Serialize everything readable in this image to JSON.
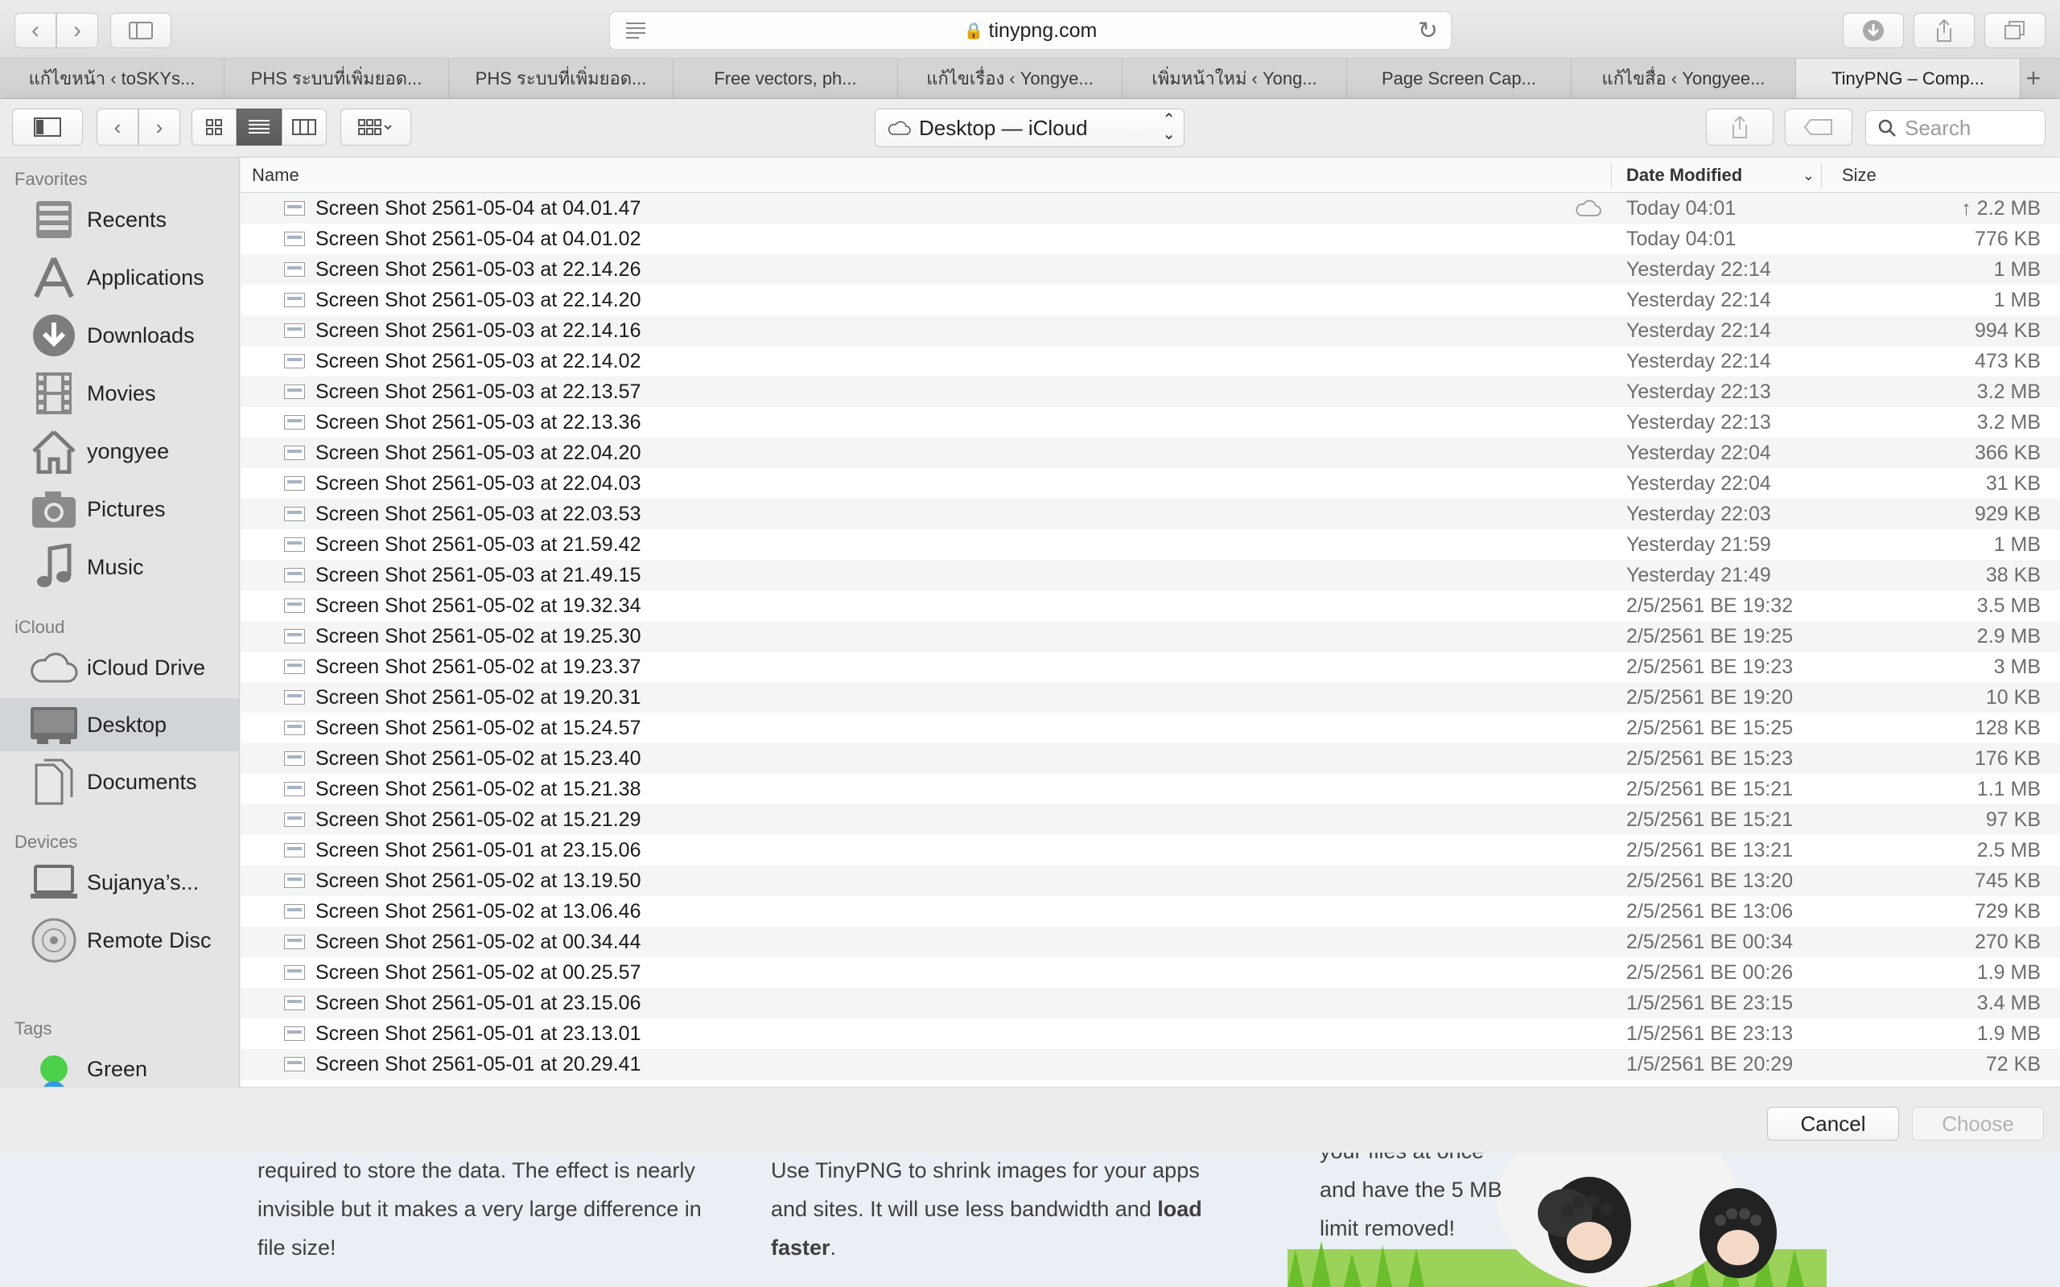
{
  "browser": {
    "url": "tinypng.com",
    "tabs": [
      {
        "label": "แก้ไขหน้า ‹ toSKYs..."
      },
      {
        "label": "PHS ระบบที่เพิ่มยอด..."
      },
      {
        "label": "PHS ระบบที่เพิ่มยอด..."
      },
      {
        "label": "Free vectors, ph..."
      },
      {
        "label": "แก้ไขเรื่อง ‹ Yongye..."
      },
      {
        "label": "เพิ่มหน้าใหม่ ‹ Yong..."
      },
      {
        "label": "Page Screen Cap..."
      },
      {
        "label": "แก้ไขสื่อ ‹ Yongyee..."
      },
      {
        "label": "TinyPNG – Comp..."
      }
    ]
  },
  "dialog": {
    "location": "Desktop — iCloud",
    "search_placeholder": "Search",
    "columns": {
      "name": "Name",
      "date": "Date Modified",
      "size": "Size"
    },
    "cancel_label": "Cancel",
    "choose_label": "Choose"
  },
  "sidebar": {
    "favorites_header": "Favorites",
    "favorites": [
      {
        "label": "Recents",
        "icon": "recents-icon"
      },
      {
        "label": "Applications",
        "icon": "applications-icon"
      },
      {
        "label": "Downloads",
        "icon": "downloads-icon"
      },
      {
        "label": "Movies",
        "icon": "movies-icon"
      },
      {
        "label": "yongyee",
        "icon": "home-icon"
      },
      {
        "label": "Pictures",
        "icon": "camera-icon"
      },
      {
        "label": "Music",
        "icon": "music-note-icon"
      }
    ],
    "icloud_header": "iCloud",
    "icloud": [
      {
        "label": "iCloud Drive",
        "icon": "cloud-icon"
      },
      {
        "label": "Desktop",
        "icon": "desktop-icon"
      },
      {
        "label": "Documents",
        "icon": "documents-icon"
      }
    ],
    "devices_header": "Devices",
    "devices": [
      {
        "label": "Sujanya’s...",
        "icon": "laptop-icon"
      },
      {
        "label": "Remote Disc",
        "icon": "disc-icon"
      }
    ],
    "tags_header": "Tags",
    "tags": [
      {
        "label": "Green",
        "color": "#4cd04b"
      }
    ]
  },
  "files": [
    {
      "name": "Screen Shot 2561-05-04 at 04.01.47",
      "date": "Today 04:01",
      "size": "↑ 2.2 MB",
      "cloud": true
    },
    {
      "name": "Screen Shot 2561-05-04 at 04.01.02",
      "date": "Today 04:01",
      "size": "776 KB"
    },
    {
      "name": "Screen Shot 2561-05-03 at 22.14.26",
      "date": "Yesterday 22:14",
      "size": "1 MB"
    },
    {
      "name": "Screen Shot 2561-05-03 at 22.14.20",
      "date": "Yesterday 22:14",
      "size": "1 MB"
    },
    {
      "name": "Screen Shot 2561-05-03 at 22.14.16",
      "date": "Yesterday 22:14",
      "size": "994 KB"
    },
    {
      "name": "Screen Shot 2561-05-03 at 22.14.02",
      "date": "Yesterday 22:14",
      "size": "473 KB"
    },
    {
      "name": "Screen Shot 2561-05-03 at 22.13.57",
      "date": "Yesterday 22:13",
      "size": "3.2 MB"
    },
    {
      "name": "Screen Shot 2561-05-03 at 22.13.36",
      "date": "Yesterday 22:13",
      "size": "3.2 MB"
    },
    {
      "name": "Screen Shot 2561-05-03 at 22.04.20",
      "date": "Yesterday 22:04",
      "size": "366 KB"
    },
    {
      "name": "Screen Shot 2561-05-03 at 22.04.03",
      "date": "Yesterday 22:04",
      "size": "31 KB"
    },
    {
      "name": "Screen Shot 2561-05-03 at 22.03.53",
      "date": "Yesterday 22:03",
      "size": "929 KB"
    },
    {
      "name": "Screen Shot 2561-05-03 at 21.59.42",
      "date": "Yesterday 21:59",
      "size": "1 MB"
    },
    {
      "name": "Screen Shot 2561-05-03 at 21.49.15",
      "date": "Yesterday 21:49",
      "size": "38 KB"
    },
    {
      "name": "Screen Shot 2561-05-02 at 19.32.34",
      "date": "2/5/2561 BE 19:32",
      "size": "3.5 MB"
    },
    {
      "name": "Screen Shot 2561-05-02 at 19.25.30",
      "date": "2/5/2561 BE 19:25",
      "size": "2.9 MB"
    },
    {
      "name": "Screen Shot 2561-05-02 at 19.23.37",
      "date": "2/5/2561 BE 19:23",
      "size": "3 MB"
    },
    {
      "name": "Screen Shot 2561-05-02 at 19.20.31",
      "date": "2/5/2561 BE 19:20",
      "size": "10 KB"
    },
    {
      "name": "Screen Shot 2561-05-02 at 15.24.57",
      "date": "2/5/2561 BE 15:25",
      "size": "128 KB"
    },
    {
      "name": "Screen Shot 2561-05-02 at 15.23.40",
      "date": "2/5/2561 BE 15:23",
      "size": "176 KB"
    },
    {
      "name": "Screen Shot 2561-05-02 at 15.21.38",
      "date": "2/5/2561 BE 15:21",
      "size": "1.1 MB"
    },
    {
      "name": "Screen Shot 2561-05-02 at 15.21.29",
      "date": "2/5/2561 BE 15:21",
      "size": "97 KB"
    },
    {
      "name": "Screen Shot 2561-05-01 at 23.15.06",
      "date": "2/5/2561 BE 13:21",
      "size": "2.5 MB"
    },
    {
      "name": "Screen Shot 2561-05-02 at 13.19.50",
      "date": "2/5/2561 BE 13:20",
      "size": "745 KB"
    },
    {
      "name": "Screen Shot 2561-05-02 at 13.06.46",
      "date": "2/5/2561 BE 13:06",
      "size": "729 KB"
    },
    {
      "name": "Screen Shot 2561-05-02 at 00.34.44",
      "date": "2/5/2561 BE 00:34",
      "size": "270 KB"
    },
    {
      "name": "Screen Shot 2561-05-02 at 00.25.57",
      "date": "2/5/2561 BE 00:26",
      "size": "1.9 MB"
    },
    {
      "name": "Screen Shot 2561-05-01 at 23.15.06",
      "date": "1/5/2561 BE 23:15",
      "size": "3.4 MB"
    },
    {
      "name": "Screen Shot 2561-05-01 at 23.13.01",
      "date": "1/5/2561 BE 23:13",
      "size": "1.9 MB"
    },
    {
      "name": "Screen Shot 2561-05-01 at 20.29.41",
      "date": "1/5/2561 BE 20:29",
      "size": "72 KB"
    }
  ],
  "page": {
    "col1": [
      "required to store the data. The effect is nearly",
      "invisible but it makes a very large difference in",
      "file size!"
    ],
    "col2_line1": "Use TinyPNG to shrink images for your apps",
    "col2_line2_a": "and sites. It will use less bandwidth and ",
    "col2_line2_b": "load",
    "col2_line3_a": "faster",
    "col2_line3_b": ".",
    "col3": [
      "your files at once",
      "and have the 5 MB",
      "limit removed!"
    ]
  }
}
